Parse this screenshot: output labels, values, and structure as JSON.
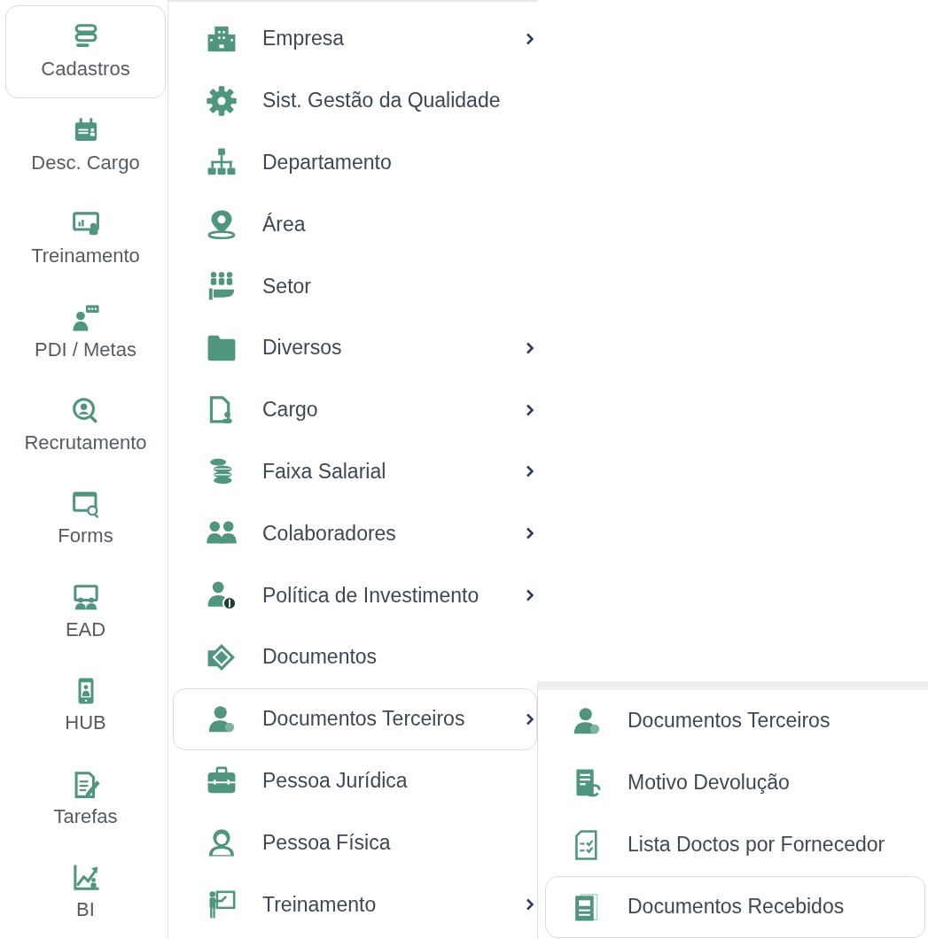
{
  "sidebar": {
    "items": [
      {
        "label": "Cadastros",
        "selected": true
      },
      {
        "label": "Desc. Cargo",
        "selected": false
      },
      {
        "label": "Treinamento",
        "selected": false
      },
      {
        "label": "PDI / Metas",
        "selected": false
      },
      {
        "label": "Recrutamento",
        "selected": false
      },
      {
        "label": "Forms",
        "selected": false
      },
      {
        "label": "EAD",
        "selected": false
      },
      {
        "label": "HUB",
        "selected": false
      },
      {
        "label": "Tarefas",
        "selected": false
      },
      {
        "label": "BI",
        "selected": false
      }
    ]
  },
  "menu": {
    "items": [
      {
        "label": "Empresa",
        "has_submenu": true,
        "selected": false
      },
      {
        "label": "Sist. Gestão da Qualidade",
        "has_submenu": false,
        "selected": false
      },
      {
        "label": "Departamento",
        "has_submenu": false,
        "selected": false
      },
      {
        "label": "Área",
        "has_submenu": false,
        "selected": false
      },
      {
        "label": "Setor",
        "has_submenu": false,
        "selected": false
      },
      {
        "label": "Diversos",
        "has_submenu": true,
        "selected": false
      },
      {
        "label": "Cargo",
        "has_submenu": true,
        "selected": false
      },
      {
        "label": "Faixa Salarial",
        "has_submenu": true,
        "selected": false
      },
      {
        "label": "Colaboradores",
        "has_submenu": true,
        "selected": false
      },
      {
        "label": "Política de Investimento",
        "has_submenu": true,
        "selected": false
      },
      {
        "label": "Documentos",
        "has_submenu": false,
        "selected": false
      },
      {
        "label": "Documentos Terceiros",
        "has_submenu": true,
        "selected": true
      },
      {
        "label": "Pessoa Jurídica",
        "has_submenu": false,
        "selected": false
      },
      {
        "label": "Pessoa Física",
        "has_submenu": false,
        "selected": false
      },
      {
        "label": "Treinamento",
        "has_submenu": true,
        "selected": false
      }
    ]
  },
  "submenu": {
    "items": [
      {
        "label": "Documentos Terceiros",
        "selected": false
      },
      {
        "label": "Motivo Devolução",
        "selected": false
      },
      {
        "label": "Lista Doctos por Fornecedor",
        "selected": false
      },
      {
        "label": "Documentos Recebidos",
        "selected": true
      }
    ]
  }
}
